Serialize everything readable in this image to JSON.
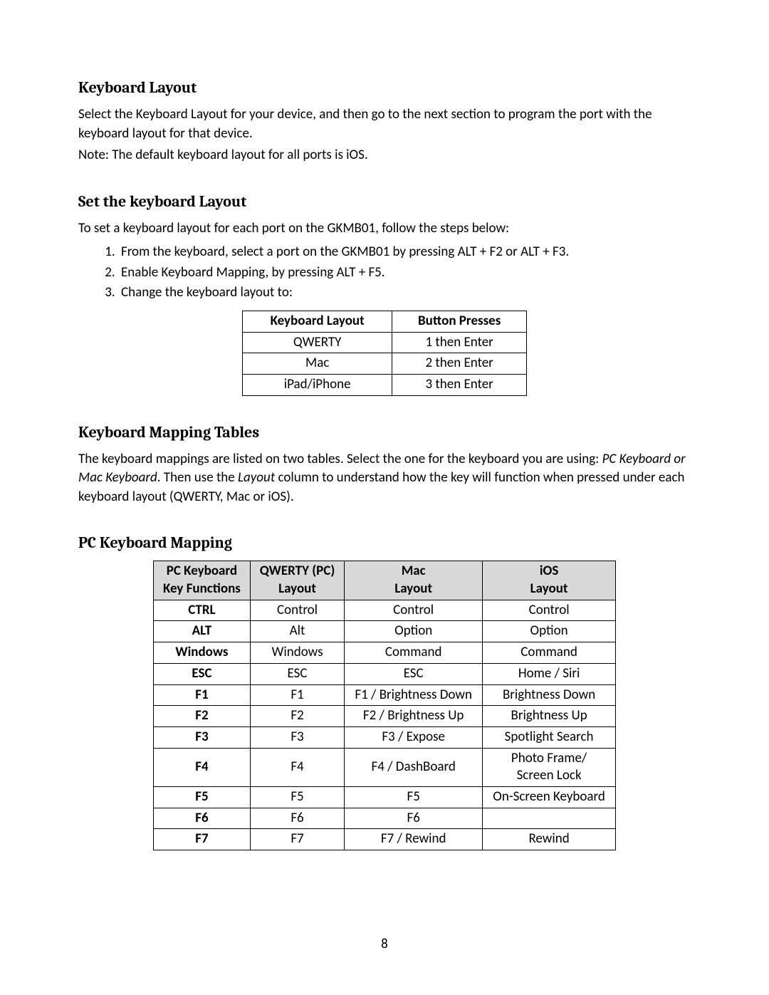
{
  "sections": {
    "keyboard_layout": {
      "heading": "Keyboard Layout",
      "para1": "Select the Keyboard Layout for your device, and then go to the next section to program the port with the keyboard layout for that device.",
      "para2": "Note: The default keyboard layout for all ports is iOS."
    },
    "set_layout": {
      "heading": "Set the keyboard Layout",
      "intro": "To set a keyboard layout for each port on the GKMB01, follow the steps below:",
      "steps": [
        "From the keyboard, select a port on the GKMB01 by pressing ALT + F2 or ALT + F3.",
        "Enable Keyboard Mapping, by pressing ALT + F5.",
        "Change the keyboard layout to:"
      ],
      "table": {
        "headers": [
          "Keyboard Layout",
          "Button Presses"
        ],
        "rows": [
          [
            "QWERTY",
            "1 then Enter"
          ],
          [
            "Mac",
            "2 then Enter"
          ],
          [
            "iPad/iPhone",
            "3 then Enter"
          ]
        ]
      }
    },
    "mapping_tables": {
      "heading": "Keyboard Mapping Tables",
      "para_a": "The keyboard mappings are listed on two tables. Select the one for the keyboard you are using: ",
      "italic1": "PC Keyboard or Mac Keyboard",
      "para_b": ". Then use the ",
      "italic2": "Layout",
      "para_c": " column to understand how the key will function when pressed under each keyboard layout (QWERTY, Mac or iOS)."
    },
    "pc_mapping": {
      "heading": "PC Keyboard Mapping",
      "headers": {
        "c1a": "PC Keyboard",
        "c1b": "Key Functions",
        "c2a": "QWERTY (PC)",
        "c2b": "Layout",
        "c3a": "Mac",
        "c3b": "Layout",
        "c4a": "iOS",
        "c4b": "Layout"
      },
      "rows": [
        {
          "k": "CTRL",
          "q": "Control",
          "m": "Control",
          "i": "Control"
        },
        {
          "k": "ALT",
          "q": "Alt",
          "m": "Option",
          "i": "Option"
        },
        {
          "k": "Windows",
          "q": "Windows",
          "m": "Command",
          "i": "Command"
        },
        {
          "k": "ESC",
          "q": "ESC",
          "m": "ESC",
          "i": "Home / Siri"
        },
        {
          "k": "F1",
          "q": "F1",
          "m": "F1 / Brightness Down",
          "i": "Brightness Down"
        },
        {
          "k": "F2",
          "q": "F2",
          "m": "F2 / Brightness Up",
          "i": "Brightness Up"
        },
        {
          "k": "F3",
          "q": "F3",
          "m": "F3 / Expose",
          "i": "Spotlight Search"
        },
        {
          "k": "F4",
          "q": "F4",
          "m": "F4 / DashBoard",
          "i": "Photo Frame/\nScreen Lock"
        },
        {
          "k": "F5",
          "q": "F5",
          "m": "F5",
          "i": "On-Screen Keyboard"
        },
        {
          "k": "F6",
          "q": "F6",
          "m": "F6",
          "i": ""
        },
        {
          "k": "F7",
          "q": "F7",
          "m": "F7 / Rewind",
          "i": "Rewind"
        }
      ]
    }
  },
  "page_number": "8"
}
